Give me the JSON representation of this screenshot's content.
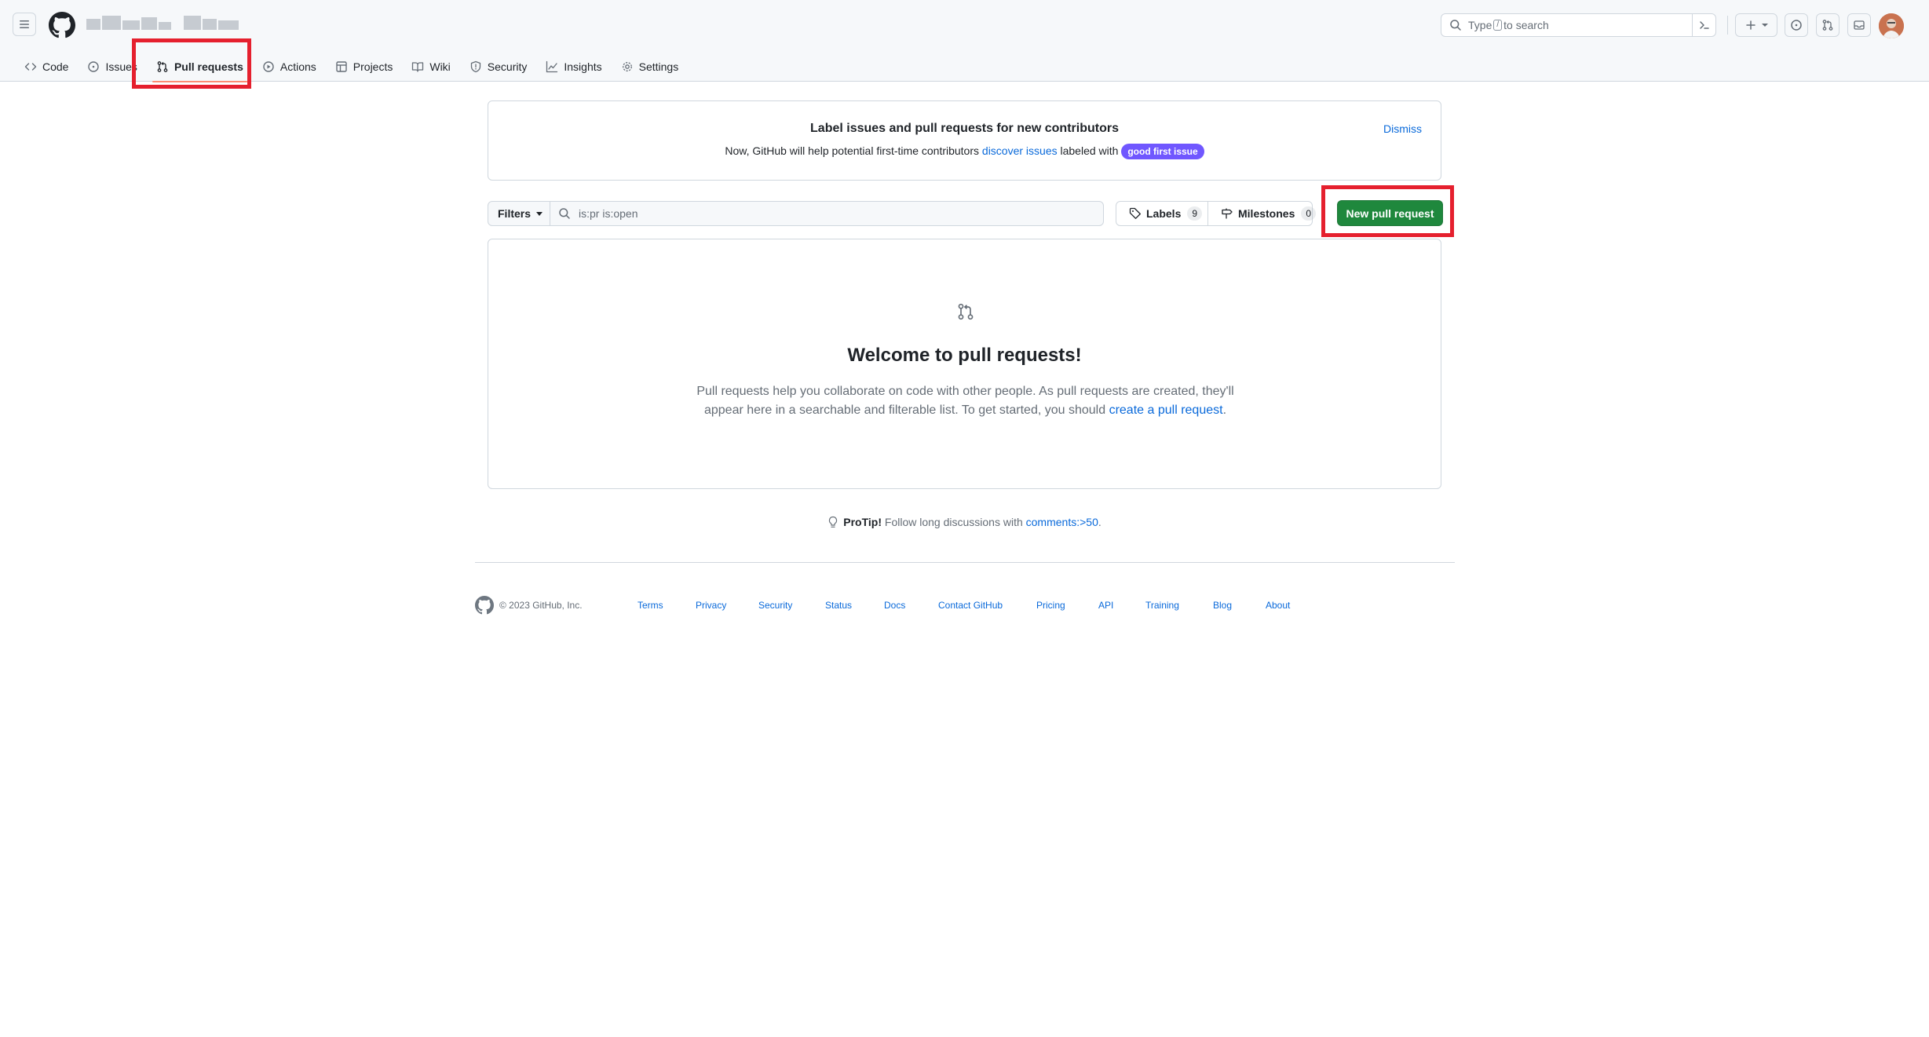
{
  "header": {
    "search_prefix": "Type",
    "search_key": "/",
    "search_suffix": "to search"
  },
  "repo_nav": {
    "code": "Code",
    "issues": "Issues",
    "pull_requests": "Pull requests",
    "actions": "Actions",
    "projects": "Projects",
    "wiki": "Wiki",
    "security": "Security",
    "insights": "Insights",
    "settings": "Settings"
  },
  "banner": {
    "title": "Label issues and pull requests for new contributors",
    "text_before": "Now, GitHub will help potential first-time contributors ",
    "link": "discover issues",
    "text_after": " labeled with ",
    "label": "good first issue",
    "dismiss": "Dismiss"
  },
  "filter_bar": {
    "filters_label": "Filters",
    "query": "is:pr is:open",
    "labels_label": "Labels",
    "labels_count": "9",
    "milestones_label": "Milestones",
    "milestones_count": "0",
    "new_pr_label": "New pull request"
  },
  "blankslate": {
    "title": "Welcome to pull requests!",
    "desc_line1": "Pull requests help you collaborate on code with other people. As pull requests are created, they'll",
    "desc_line2": "appear here in a searchable and filterable list. To get started, you should ",
    "desc_link": "create a pull request",
    "desc_end": "."
  },
  "protip": {
    "label": "ProTip!",
    "text": " Follow long discussions with ",
    "link": "comments:>50",
    "end": "."
  },
  "footer": {
    "copyright": "© 2023 GitHub, Inc.",
    "links": [
      "Terms",
      "Privacy",
      "Security",
      "Status",
      "Docs",
      "Contact GitHub",
      "Pricing",
      "API",
      "Training",
      "Blog",
      "About"
    ]
  },
  "colors": {
    "accent_link": "#0969da",
    "primary_button": "#1f883d",
    "highlight_box": "#e5202e",
    "good_first_issue": "#7057ff",
    "active_tab_underline": "#fd8c73"
  }
}
